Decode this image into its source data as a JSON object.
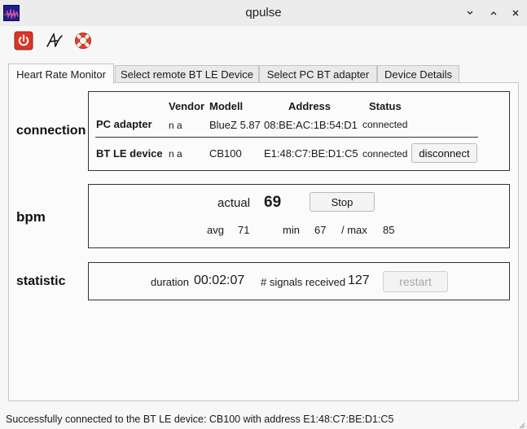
{
  "window": {
    "title": "qpulse",
    "minimize": "⌄",
    "maximize": "⌃",
    "close": "✕"
  },
  "toolbar": {
    "items": [
      {
        "icon": "power-icon",
        "color": "#d9352a"
      },
      {
        "icon": "about-signature-icon"
      },
      {
        "icon": "lifebuoy-icon",
        "color": "#e0452f"
      }
    ]
  },
  "tabs": [
    {
      "label": "Heart Rate Monitor",
      "active": true
    },
    {
      "label": "Select remote BT LE Device",
      "active": false
    },
    {
      "label": "Select PC BT adapter",
      "active": false
    },
    {
      "label": "Device Details",
      "active": false
    }
  ],
  "connection": {
    "label": "connection",
    "headers": {
      "vendor": "Vendor",
      "model": "Modell",
      "address": "Address",
      "status": "Status"
    },
    "pc_adapter": {
      "label": "PC adapter",
      "vendor": "n a",
      "model": "BlueZ 5.87",
      "address": "08:BE:AC:1B:54:D1",
      "status": "connected"
    },
    "bt_device": {
      "label": "BT LE device",
      "vendor": "n a",
      "model": "CB100",
      "address": "E1:48:C7:BE:D1:C5",
      "status": "connected",
      "button": "disconnect"
    }
  },
  "bpm": {
    "label": "bpm",
    "actual_label": "actual",
    "actual_value": "69",
    "stop_button": "Stop",
    "avg_label": "avg",
    "avg_value": "71",
    "min_label": "min",
    "min_value": "67",
    "max_label": "/ max",
    "max_value": "85"
  },
  "statistic": {
    "label": "statistic",
    "duration_label": "duration",
    "duration_value": "00:02:07",
    "signals_label": "# signals received",
    "signals_value": "127",
    "restart_button": "restart"
  },
  "statusbar": {
    "message": "Successfully connected to the BT LE device: CB100 with address E1:48:C7:BE:D1:C5"
  }
}
